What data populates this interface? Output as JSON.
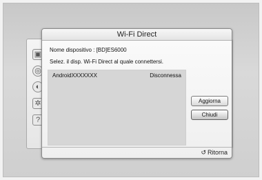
{
  "dialog": {
    "title": "Wi-Fi Direct",
    "device_name_line": "Nome dispositivo : [BD]ES6000",
    "instruction": "Selez. il disp. Wi-Fi Direct al quale connettersi.",
    "devices": [
      {
        "name": "AndroidXXXXXXX",
        "status": "Disconnessa"
      }
    ],
    "buttons": {
      "refresh": "Aggiorna",
      "close": "Chiudi"
    },
    "footer": {
      "return_label": "Ritorna",
      "return_icon": "return-arrow-icon"
    }
  },
  "background_menu": {
    "icons": [
      "photo-icon",
      "disc-icon",
      "globe-icon",
      "gear-icon",
      "support-icon"
    ]
  }
}
